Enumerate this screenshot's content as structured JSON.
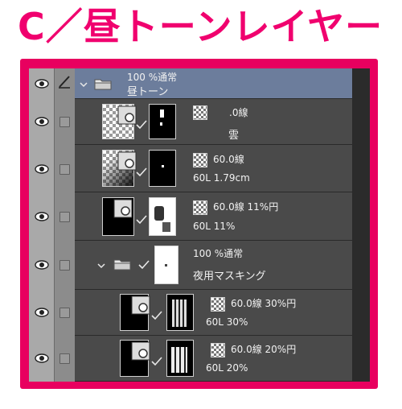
{
  "heading": "C／昼トーンレイヤー",
  "colors": {
    "accent": "#e8005f",
    "selected_row": "#6c7d9c",
    "panel_bg": "#4a4a4a"
  },
  "layers": [
    {
      "kind": "folder",
      "selected": true,
      "line1": "100 %通常",
      "line2": "昼トーン"
    },
    {
      "kind": "layer",
      "line1": ".0線",
      "line2": "雲"
    },
    {
      "kind": "layer",
      "line1": "60.0線",
      "line2": "60L 1.79cm"
    },
    {
      "kind": "layer",
      "line1": "60.0線 11%円",
      "line2": "60L 11%"
    },
    {
      "kind": "folder",
      "line1": "100 %通常",
      "line2": "夜用マスキング"
    },
    {
      "kind": "layer",
      "line1": "60.0線 30%円",
      "line2": "60L 30%"
    },
    {
      "kind": "layer",
      "line1": "60.0線 20%円",
      "line2": "60L 20%"
    }
  ]
}
